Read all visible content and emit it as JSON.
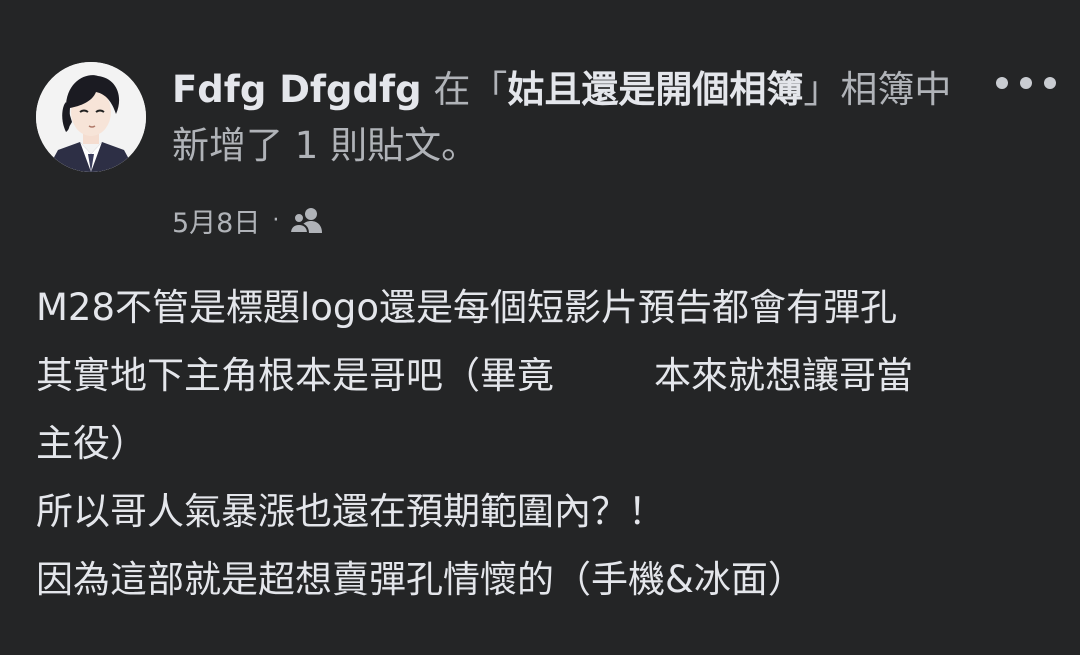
{
  "post": {
    "author": "Fdfg Dfgdfg",
    "header_pre": " 在「",
    "album_name": "姑且還是開個相簿",
    "header_post": "」相簿中新增了 1 則貼文。",
    "date": "5月8日",
    "separator": "·",
    "audience_icon": "friends-icon",
    "more_icon": "more-options-icon",
    "body_lines": [
      "M28不管是標題logo還是每個短影片預告都會有彈孔",
      "其實地下主角根本是哥吧（畢竟",
      "本來就想讓哥當",
      "主役）",
      "所以哥人氣暴漲也還在預期範圍內？！",
      "因為這部就是超想賣彈孔情懷的（手機&冰面）"
    ]
  },
  "colors": {
    "background": "#242526",
    "primary_text": "#e4e6eb",
    "secondary_text": "#b0b3b8"
  }
}
